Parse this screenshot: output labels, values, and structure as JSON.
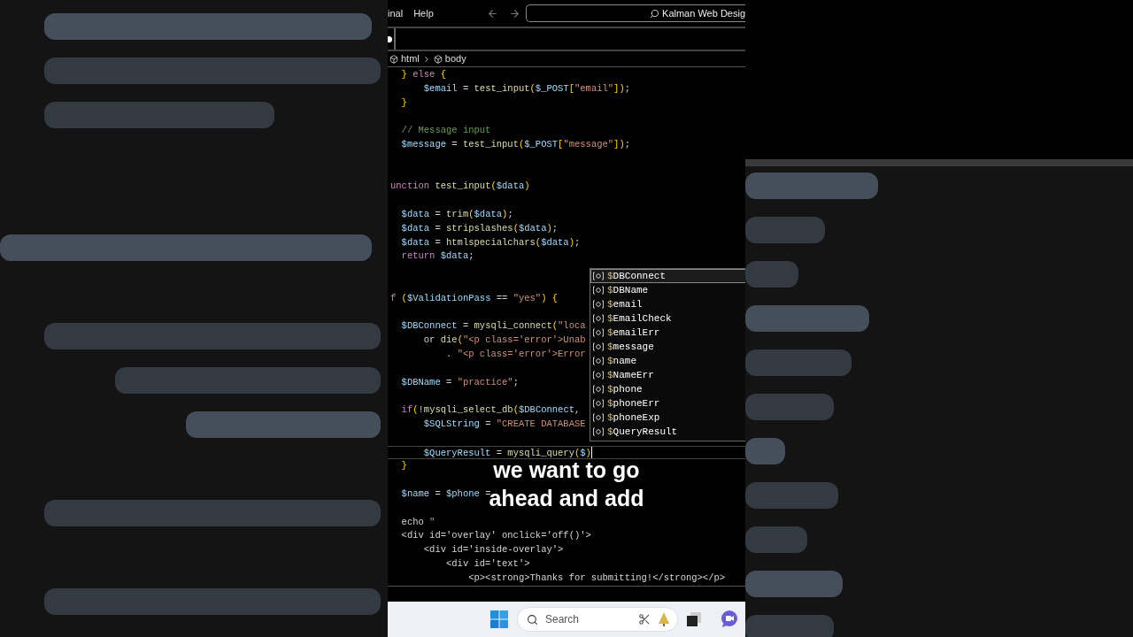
{
  "backdrop": {
    "kind": "picture"
  },
  "menu": [
    "inal",
    "Help"
  ],
  "command_center": {
    "value": "Kalman Web Desig"
  },
  "breadcrumb": [
    "html",
    "body"
  ],
  "code_lines": [
    {
      "kind": "code",
      "tokens": [
        {
          "kind": "bracket",
          "text": "  }"
        },
        {
          "kind": "keyword",
          "text": " else "
        },
        {
          "kind": "bracket",
          "text": "{"
        }
      ]
    },
    {
      "kind": "code",
      "tokens": [
        {
          "kind": "variable",
          "text": "      $email"
        },
        {
          "kind": "plain",
          "text": " = "
        },
        {
          "kind": "function",
          "text": "test_input"
        },
        {
          "kind": "bracket",
          "text": "("
        },
        {
          "kind": "variable",
          "text": "$_POST"
        },
        {
          "kind": "bracket",
          "text": "["
        },
        {
          "kind": "string",
          "text": "\"email\""
        },
        {
          "kind": "bracket",
          "text": "])"
        },
        {
          "kind": "plain",
          "text": ";"
        }
      ]
    },
    {
      "kind": "code",
      "tokens": [
        {
          "kind": "bracket",
          "text": "  }"
        }
      ]
    },
    {
      "kind": "blank"
    },
    {
      "kind": "code",
      "tokens": [
        {
          "kind": "comment",
          "text": "  // Message input"
        }
      ]
    },
    {
      "kind": "code",
      "tokens": [
        {
          "kind": "variable",
          "text": "  $message"
        },
        {
          "kind": "plain",
          "text": " = "
        },
        {
          "kind": "function",
          "text": "test_input"
        },
        {
          "kind": "bracket",
          "text": "("
        },
        {
          "kind": "variable",
          "text": "$_POST"
        },
        {
          "kind": "bracket",
          "text": "["
        },
        {
          "kind": "string",
          "text": "\"message\""
        },
        {
          "kind": "bracket",
          "text": "])"
        },
        {
          "kind": "plain",
          "text": ";"
        }
      ]
    },
    {
      "kind": "blank"
    },
    {
      "kind": "blank"
    },
    {
      "kind": "code",
      "tokens": [
        {
          "kind": "keyword",
          "text": "unction "
        },
        {
          "kind": "function",
          "text": "test_input"
        },
        {
          "kind": "bracket",
          "text": "("
        },
        {
          "kind": "variable",
          "text": "$data"
        },
        {
          "kind": "bracket",
          "text": ")"
        }
      ]
    },
    {
      "kind": "blank"
    },
    {
      "kind": "code",
      "tokens": [
        {
          "kind": "variable",
          "text": "  $data"
        },
        {
          "kind": "plain",
          "text": " = "
        },
        {
          "kind": "function",
          "text": "trim"
        },
        {
          "kind": "bracket",
          "text": "("
        },
        {
          "kind": "variable",
          "text": "$data"
        },
        {
          "kind": "bracket",
          "text": ")"
        },
        {
          "kind": "plain",
          "text": ";"
        }
      ]
    },
    {
      "kind": "code",
      "tokens": [
        {
          "kind": "variable",
          "text": "  $data"
        },
        {
          "kind": "plain",
          "text": " = "
        },
        {
          "kind": "function",
          "text": "stripslashes"
        },
        {
          "kind": "bracket",
          "text": "("
        },
        {
          "kind": "variable",
          "text": "$data"
        },
        {
          "kind": "bracket",
          "text": ")"
        },
        {
          "kind": "plain",
          "text": ";"
        }
      ]
    },
    {
      "kind": "code",
      "tokens": [
        {
          "kind": "variable",
          "text": "  $data"
        },
        {
          "kind": "plain",
          "text": " = "
        },
        {
          "kind": "function",
          "text": "htmlspecialchars"
        },
        {
          "kind": "bracket",
          "text": "("
        },
        {
          "kind": "variable",
          "text": "$data"
        },
        {
          "kind": "bracket",
          "text": ")"
        },
        {
          "kind": "plain",
          "text": ";"
        }
      ]
    },
    {
      "kind": "code",
      "tokens": [
        {
          "kind": "keyword",
          "text": "  return "
        },
        {
          "kind": "variable",
          "text": "$data"
        },
        {
          "kind": "plain",
          "text": ";"
        }
      ]
    },
    {
      "kind": "blank"
    },
    {
      "kind": "blank"
    },
    {
      "kind": "code",
      "tokens": [
        {
          "kind": "keyword",
          "text": "f "
        },
        {
          "kind": "bracket",
          "text": "("
        },
        {
          "kind": "variable",
          "text": "$ValidationPass"
        },
        {
          "kind": "plain",
          "text": " == "
        },
        {
          "kind": "string",
          "text": "\"yes\""
        },
        {
          "kind": "bracket",
          "text": ") {"
        }
      ]
    },
    {
      "kind": "blank"
    },
    {
      "kind": "code",
      "tokens": [
        {
          "kind": "variable",
          "text": "  $DBConnect"
        },
        {
          "kind": "plain",
          "text": " = "
        },
        {
          "kind": "function",
          "text": "mysqli_connect"
        },
        {
          "kind": "bracket",
          "text": "("
        },
        {
          "kind": "string",
          "text": "\"loca"
        }
      ]
    },
    {
      "kind": "code",
      "tokens": [
        {
          "kind": "plain",
          "text": "      or "
        },
        {
          "kind": "function",
          "text": "die"
        },
        {
          "kind": "bracket",
          "text": "("
        },
        {
          "kind": "string",
          "text": "\"<p class='error'>Unab"
        }
      ]
    },
    {
      "kind": "code",
      "tokens": [
        {
          "kind": "plain",
          "text": "          . "
        },
        {
          "kind": "string",
          "text": "\"<p class='error'>Error"
        }
      ]
    },
    {
      "kind": "blank"
    },
    {
      "kind": "code",
      "tokens": [
        {
          "kind": "variable",
          "text": "  $DBName"
        },
        {
          "kind": "plain",
          "text": " = "
        },
        {
          "kind": "string",
          "text": "\"practice\""
        },
        {
          "kind": "plain",
          "text": ";"
        }
      ]
    },
    {
      "kind": "blank"
    },
    {
      "kind": "code",
      "tokens": [
        {
          "kind": "keyword",
          "text": "  if"
        },
        {
          "kind": "bracket",
          "text": "("
        },
        {
          "kind": "plain",
          "text": "!"
        },
        {
          "kind": "function",
          "text": "mysqli_select_db"
        },
        {
          "kind": "bracket",
          "text": "("
        },
        {
          "kind": "variable",
          "text": "$DBConnect"
        },
        {
          "kind": "plain",
          "text": ","
        }
      ]
    },
    {
      "kind": "code",
      "tokens": [
        {
          "kind": "variable",
          "text": "      $SQLString"
        },
        {
          "kind": "plain",
          "text": " = "
        },
        {
          "kind": "string",
          "text": "\"CREATE DATABASE"
        }
      ]
    },
    {
      "kind": "blank"
    },
    {
      "kind": "current",
      "tokens": [
        {
          "kind": "variable",
          "text": "      $QueryResult"
        },
        {
          "kind": "plain",
          "text": " = "
        },
        {
          "kind": "function",
          "text": "mysqli_query"
        },
        {
          "kind": "bracket",
          "text": "("
        },
        {
          "kind": "variable",
          "text": "$"
        },
        {
          "kind": "bracket",
          "text": ")"
        }
      ]
    },
    {
      "kind": "code",
      "tokens": [
        {
          "kind": "bracket",
          "text": "  }"
        }
      ]
    },
    {
      "kind": "blank"
    },
    {
      "kind": "code",
      "tokens": [
        {
          "kind": "variable",
          "text": "  $name"
        },
        {
          "kind": "plain",
          "text": " = "
        },
        {
          "kind": "variable",
          "text": "$phone"
        },
        {
          "kind": "plain",
          "text": " ="
        }
      ]
    },
    {
      "kind": "blank"
    },
    {
      "kind": "code",
      "tokens": [
        {
          "kind": "plain",
          "text": "  echo "
        },
        {
          "kind": "string",
          "text": "\""
        }
      ]
    },
    {
      "kind": "code",
      "tokens": [
        {
          "kind": "plain",
          "text": "  <div id='overlay' onclick='off()'>"
        }
      ]
    },
    {
      "kind": "code",
      "tokens": [
        {
          "kind": "plain",
          "text": "      <div id='inside-overlay'>"
        }
      ]
    },
    {
      "kind": "code",
      "tokens": [
        {
          "kind": "plain",
          "text": "          <div id='text'>"
        }
      ]
    },
    {
      "kind": "code",
      "tokens": [
        {
          "kind": "plain",
          "text": "              <p><strong>Thanks for submitting!</strong></p>"
        }
      ]
    }
  ],
  "suggestions": [
    {
      "label": "$DBConnect",
      "selected": true
    },
    {
      "label": "$DBName",
      "selected": false
    },
    {
      "label": "$email",
      "selected": false
    },
    {
      "label": "$EmailCheck",
      "selected": false
    },
    {
      "label": "$emailErr",
      "selected": false
    },
    {
      "label": "$message",
      "selected": false
    },
    {
      "label": "$name",
      "selected": false
    },
    {
      "label": "$NameErr",
      "selected": false
    },
    {
      "label": "$phone",
      "selected": false
    },
    {
      "label": "$phoneErr",
      "selected": false
    },
    {
      "label": "$phoneExp",
      "selected": false
    },
    {
      "label": "$QueryResult",
      "selected": false
    }
  ],
  "caption": [
    "we want to go",
    "ahead and add"
  ],
  "taskbar": {
    "search_placeholder": "Search"
  }
}
